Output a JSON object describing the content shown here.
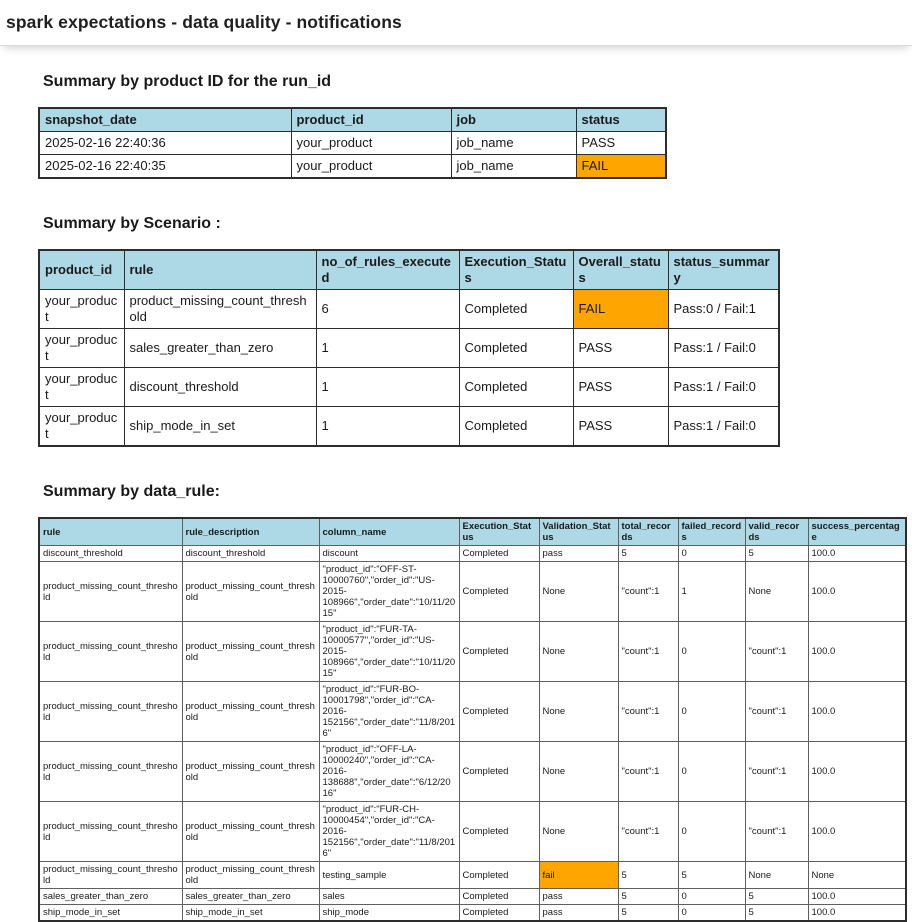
{
  "title_bar": {
    "title": "spark expectations - data quality - notifications"
  },
  "colors": {
    "table_header_bg": "#ADD8E6",
    "fail_highlight_bg": "#FFA500"
  },
  "sections": [
    {
      "heading": "Summary by product ID for the run_id",
      "table": {
        "headers": [
          "snapshot_date",
          "product_id",
          "job",
          "status"
        ],
        "rows": [
          [
            "2025-02-16 22:40:36",
            "your_product",
            "job_name",
            "PASS"
          ],
          [
            "2025-02-16 22:40:35",
            "your_product",
            "job_name",
            {
              "text": "FAIL",
              "bg": "#FFA500"
            }
          ]
        ]
      }
    },
    {
      "heading": "Summary by Scenario :",
      "table": {
        "headers": [
          "product_id",
          "rule",
          "no_of_rules_executed",
          "Execution_Status",
          "Overall_status",
          "status_summary"
        ],
        "rows": [
          [
            "your_product",
            "product_missing_count_threshold",
            "6",
            "Completed",
            {
              "text": "FAIL",
              "bg": "#FFA500"
            },
            "Pass:0 / Fail:1"
          ],
          [
            "your_product",
            "sales_greater_than_zero",
            "1",
            "Completed",
            "PASS",
            "Pass:1 / Fail:0"
          ],
          [
            "your_product",
            "discount_threshold",
            "1",
            "Completed",
            "PASS",
            "Pass:1 / Fail:0"
          ],
          [
            "your_product",
            "ship_mode_in_set",
            "1",
            "Completed",
            "PASS",
            "Pass:1 / Fail:0"
          ]
        ]
      }
    },
    {
      "heading": "Summary by data_rule:",
      "table": {
        "headers": [
          "rule",
          "rule_description",
          "column_name",
          "Execution_Status",
          "Validation_Status",
          "total_records",
          "failed_records",
          "valid_records",
          "success_percentage"
        ],
        "rows": [
          [
            "discount_threshold",
            "discount_threshold",
            "discount",
            "Completed",
            "pass",
            "5",
            "0",
            "5",
            "100.0"
          ],
          [
            "product_missing_count_threshold",
            "product_missing_count_threshold",
            "\"product_id\":\"OFF-ST-10000760\",\"order_id\":\"US-2015-108966\",\"order_date\":\"10/11/2015\"",
            "Completed",
            "None",
            "\"count\":1",
            "1",
            "None",
            "100.0"
          ],
          [
            "product_missing_count_threshold",
            "product_missing_count_threshold",
            "\"product_id\":\"FUR-TA-10000577\",\"order_id\":\"US-2015-108966\",\"order_date\":\"10/11/2015\"",
            "Completed",
            "None",
            "\"count\":1",
            "0",
            "\"count\":1",
            "100.0"
          ],
          [
            "product_missing_count_threshold",
            "product_missing_count_threshold",
            "\"product_id\":\"FUR-BO-10001798\",\"order_id\":\"CA-2016-152156\",\"order_date\":\"11/8/2016\"",
            "Completed",
            "None",
            "\"count\":1",
            "0",
            "\"count\":1",
            "100.0"
          ],
          [
            "product_missing_count_threshold",
            "product_missing_count_threshold",
            "\"product_id\":\"OFF-LA-10000240\",\"order_id\":\"CA-2016-138688\",\"order_date\":\"6/12/2016\"",
            "Completed",
            "None",
            "\"count\":1",
            "0",
            "\"count\":1",
            "100.0"
          ],
          [
            "product_missing_count_threshold",
            "product_missing_count_threshold",
            "\"product_id\":\"FUR-CH-10000454\",\"order_id\":\"CA-2016-152156\",\"order_date\":\"11/8/2016\"",
            "Completed",
            "None",
            "\"count\":1",
            "0",
            "\"count\":1",
            "100.0"
          ],
          [
            "product_missing_count_threshold",
            "product_missing_count_threshold",
            "testing_sample",
            "Completed",
            {
              "text": "fail",
              "bg": "#FFA500"
            },
            "5",
            "5",
            "None",
            "None"
          ],
          [
            "sales_greater_than_zero",
            "sales_greater_than_zero",
            "sales",
            "Completed",
            "pass",
            "5",
            "0",
            "5",
            "100.0"
          ],
          [
            "ship_mode_in_set",
            "ship_mode_in_set",
            "ship_mode",
            "Completed",
            "pass",
            "5",
            "0",
            "5",
            "100.0"
          ]
        ]
      }
    }
  ]
}
